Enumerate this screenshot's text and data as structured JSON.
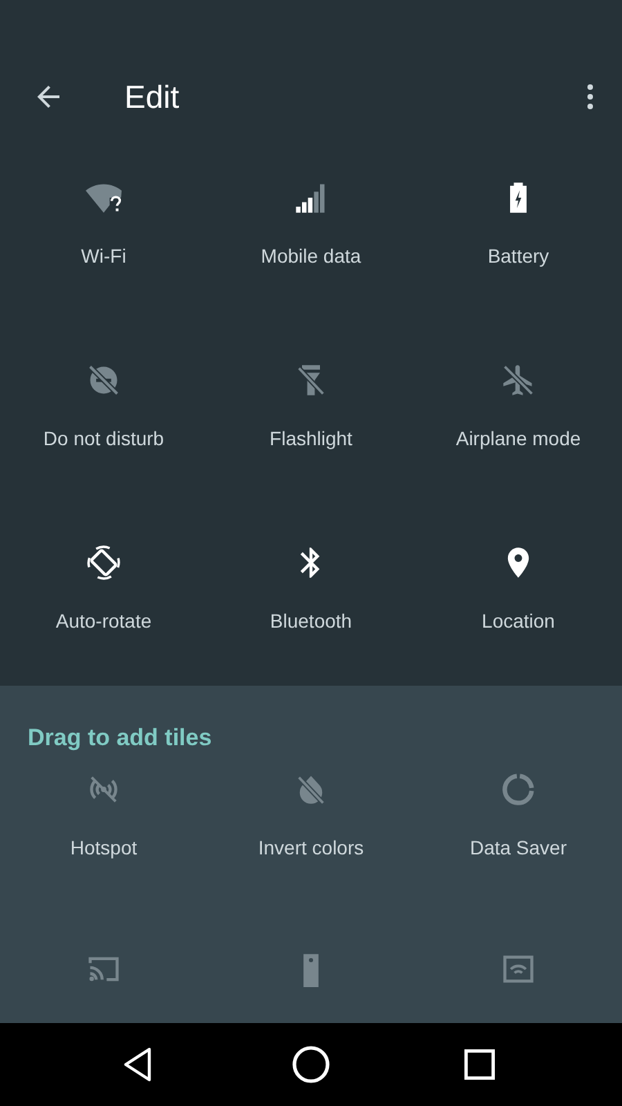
{
  "header": {
    "title": "Edit"
  },
  "tiles": [
    {
      "label": "Wi-Fi",
      "kind": "wifi",
      "on": false
    },
    {
      "label": "Mobile data",
      "kind": "signal",
      "on": true
    },
    {
      "label": "Battery",
      "kind": "battery",
      "on": true
    },
    {
      "label": "Do not disturb",
      "kind": "dnd",
      "on": false
    },
    {
      "label": "Flashlight",
      "kind": "flashlight",
      "on": false
    },
    {
      "label": "Airplane mode",
      "kind": "airplane",
      "on": false
    },
    {
      "label": "Auto-rotate",
      "kind": "rotate",
      "on": true
    },
    {
      "label": "Bluetooth",
      "kind": "bluetooth",
      "on": true
    },
    {
      "label": "Location",
      "kind": "location",
      "on": true
    }
  ],
  "available": {
    "title": "Drag to add tiles",
    "tiles": [
      {
        "label": "Hotspot",
        "kind": "hotspot",
        "on": false
      },
      {
        "label": "Invert colors",
        "kind": "invert",
        "on": false
      },
      {
        "label": "Data Saver",
        "kind": "datasaver",
        "on": false
      },
      {
        "kind": "cast",
        "on": false
      },
      {
        "kind": "phone",
        "on": false
      },
      {
        "kind": "screen",
        "on": false
      }
    ]
  }
}
